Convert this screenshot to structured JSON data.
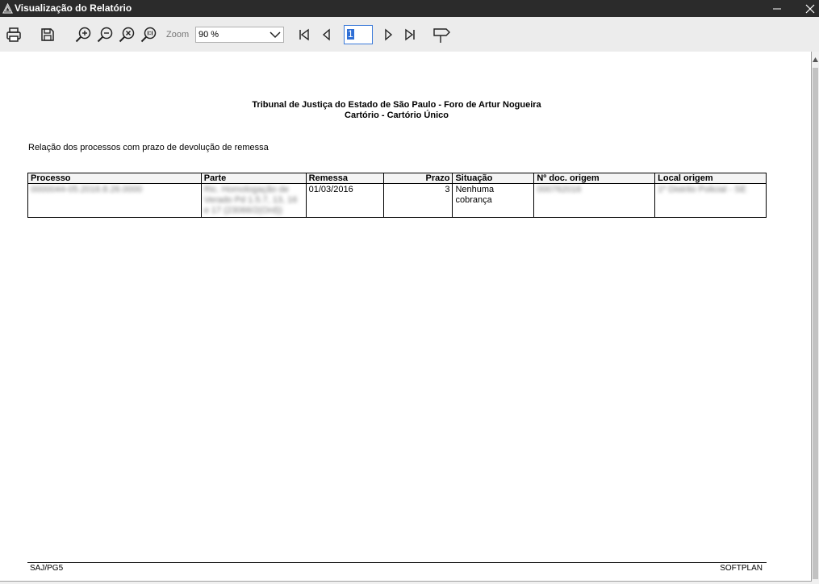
{
  "window": {
    "title": "Visualização do Relatório"
  },
  "toolbar": {
    "zoom_label": "Zoom",
    "zoom_value": "90 %",
    "page_value": "1"
  },
  "report": {
    "header_line1": "Tribunal de Justiça do Estado de São Paulo - Foro de Artur Nogueira",
    "header_line2": "Cartório - Cartório Único",
    "subtitle": "Relação dos processos com prazo de devolução de remessa",
    "columns": [
      "Processo",
      "Parte",
      "Remessa",
      "Prazo",
      "Situação",
      "Nº doc. origem",
      "Local origem"
    ],
    "rows": [
      {
        "processo": "0000044-05.2016.8.26.0000",
        "parte": "Ric. Homologação de Verado Pd 1.5.7, 13, 16 e 17 (23066/2(Ord))",
        "remessa": "01/03/2016",
        "prazo": "3",
        "situacao": "Nenhuma cobrança",
        "doc_origem": "000762016",
        "local_origem": "1º Distrito Policial - SE"
      }
    ],
    "footer_left": "SAJ/PG5",
    "footer_right": "SOFTPLAN"
  }
}
